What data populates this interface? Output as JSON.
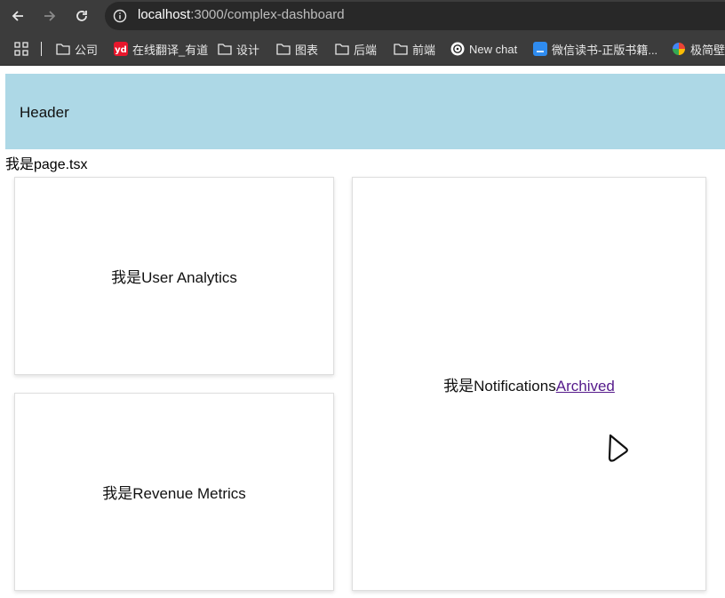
{
  "browser": {
    "url_host": "localhost",
    "url_rest": ":3000/complex-dashboard",
    "bookmarks": [
      {
        "label": "",
        "icon": "apps-grid-icon"
      },
      {
        "label": "公司",
        "icon": "folder-icon"
      },
      {
        "label": "在线翻译_有道",
        "icon": "youdao-icon"
      },
      {
        "label": "设计",
        "icon": "folder-icon"
      },
      {
        "label": "图表",
        "icon": "folder-icon"
      },
      {
        "label": "后端",
        "icon": "folder-icon"
      },
      {
        "label": "前端",
        "icon": "folder-icon"
      },
      {
        "label": "New chat",
        "icon": "openai-icon"
      },
      {
        "label": "微信读书-正版书籍...",
        "icon": "weread-icon"
      },
      {
        "label": "极简壁纸",
        "icon": "colorful-pinwheel-icon"
      }
    ]
  },
  "page": {
    "header": "Header",
    "page_label": "我是page.tsx",
    "cards": {
      "user_analytics": "我是User Analytics",
      "revenue_metrics": "我是Revenue Metrics",
      "notifications": "我是Notifications",
      "archived_link": "Archived"
    }
  },
  "colors": {
    "header_bg": "#add8e6",
    "link": "#551a8b",
    "chrome": "#3c3c3c"
  }
}
